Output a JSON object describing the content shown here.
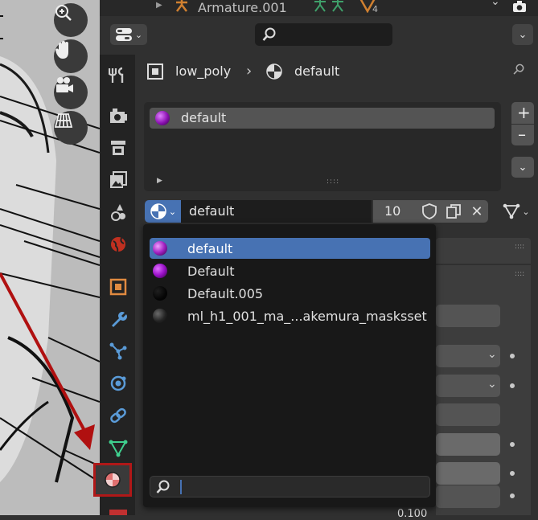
{
  "outliner": {
    "item_label": "Armature.001",
    "count": "4"
  },
  "header": {
    "search_placeholder": ""
  },
  "breadcrumb": {
    "object": "low_poly",
    "material": "default"
  },
  "slot_list": {
    "items": [
      "default"
    ]
  },
  "material_selector": {
    "name": "default",
    "users": "10"
  },
  "popup": {
    "items": [
      {
        "name": "default",
        "color": "#a020c0",
        "selected": true
      },
      {
        "name": "Default",
        "color": "#9a10c8",
        "selected": false
      },
      {
        "name": "Default.005",
        "color": "#050505",
        "selected": false
      },
      {
        "name": "ml_h1_001_ma_...akemura_masksset",
        "color": "#303030",
        "selected": false
      }
    ],
    "search_value": ""
  },
  "bottom_value": "0.100",
  "colors": {
    "accent": "#4772b3",
    "highlight_box": "#b01818",
    "arrow": "#b01010"
  },
  "tabs": [
    "tool-tab",
    "render-tab",
    "output-tab",
    "view-layer-tab",
    "scene-tab",
    "world-tab",
    "object-tab",
    "modifier-tab",
    "particles-tab",
    "physics-tab",
    "constraints-tab",
    "data-tab",
    "material-tab"
  ]
}
